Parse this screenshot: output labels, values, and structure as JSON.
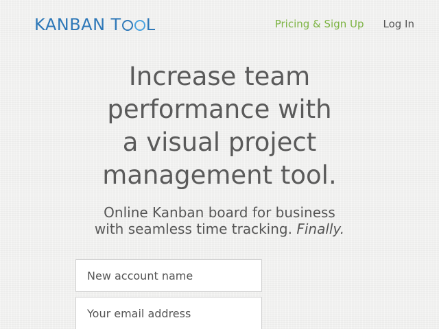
{
  "header": {
    "logo_text_left": "KANBAN",
    "logo_text_t": "T",
    "logo_text_right": "L",
    "nav": {
      "pricing_label": "Pricing & Sign Up",
      "login_label": "Log In"
    }
  },
  "hero": {
    "title_lines": [
      "Increase team",
      "performance with",
      "a visual project",
      "management tool."
    ],
    "subtitle_line1": "Online Kanban board for business",
    "subtitle_line2": "with seamless time tracking.",
    "subtitle_emphasis": "Finally."
  },
  "signup_form": {
    "account_name_placeholder": "New account name",
    "email_placeholder": "Your email address"
  },
  "colors": {
    "logo_blue": "#2e78b8",
    "logo_light_blue": "#4aa3e0",
    "pricing_link_green": "#7cb342",
    "text_gray": "#555555",
    "background": "#f1f1f0"
  }
}
